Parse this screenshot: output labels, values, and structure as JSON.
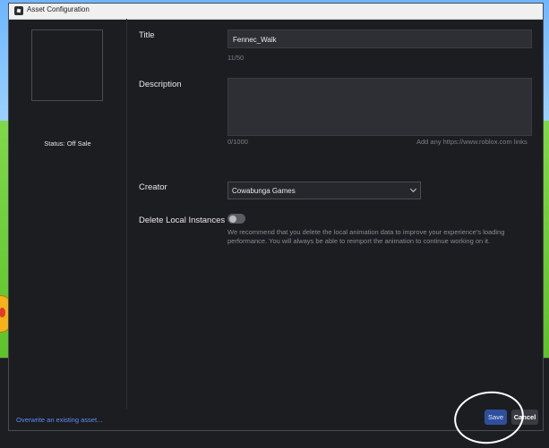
{
  "window": {
    "title": "Asset Configuration"
  },
  "left_panel": {
    "status": "Status: Off Sale"
  },
  "form": {
    "title_label": "Title",
    "title_value": "Fennec_Walk",
    "title_count": "11/50",
    "description_label": "Description",
    "description_value": "",
    "description_count": "0/1000",
    "description_hint": "Add any https://www.roblox.com links",
    "creator_label": "Creator",
    "creator_value": "Cowabunga Games",
    "delete_local_label": "Delete Local Instances",
    "delete_local_on": false,
    "delete_local_note": "We recommend that you delete the local animation data to improve your experience's loading performance. You will always be able to reimport the animation to continue working on it."
  },
  "footer": {
    "overwrite_link": "Overwrite an existing asset...",
    "save_label": "Save",
    "cancel_label": "Cancel"
  },
  "colors": {
    "accent": "#2f4f9c",
    "link": "#5b8ff5",
    "panel": "#1c1d21"
  }
}
